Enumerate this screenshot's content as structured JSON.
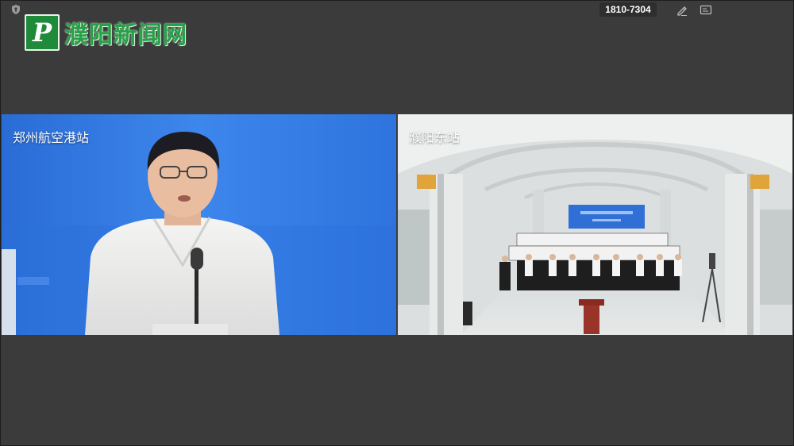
{
  "header": {
    "logo_letter": "P",
    "logo_text": "濮阳新闻网",
    "meeting_id": "1810-7304"
  },
  "icons": {
    "top_left": "shield-icon",
    "toolbar": [
      "edit-icon",
      "screen-share-icon"
    ]
  },
  "videos": [
    {
      "label": "郑州航空港站",
      "background": "#2f77e0"
    },
    {
      "label": "濮阳东站",
      "background": "#d9dcdc"
    }
  ],
  "colors": {
    "background": "#3b3b3b",
    "logo_green": "#27a148",
    "banner_blue": "#2f6fd6"
  }
}
